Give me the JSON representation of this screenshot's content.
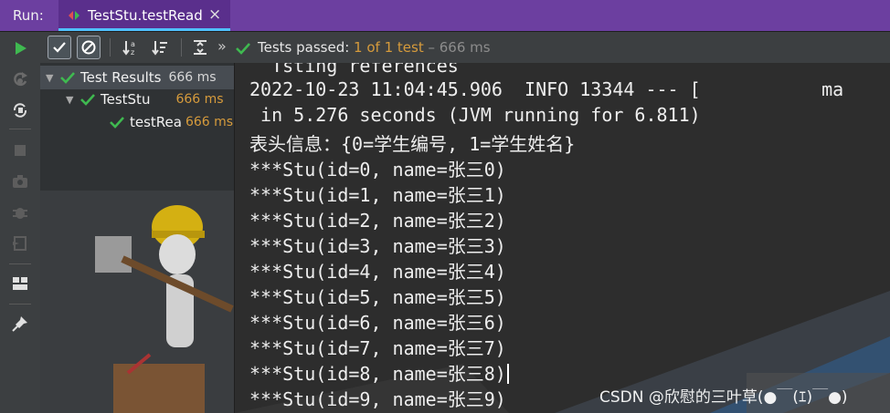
{
  "run_bar": {
    "label": "Run:",
    "tab_title": "TestStu.testRead",
    "close_glyph": "×"
  },
  "toolbar": {
    "overflow_glyph": "»",
    "status_passed": "Tests passed: ",
    "status_count": "1 of 1 test",
    "status_duration": "– 666 ms"
  },
  "tree": {
    "root": {
      "label": "Test Results",
      "time": "666 ms"
    },
    "class_node": {
      "label": "TestStu",
      "time": "666 ms"
    },
    "method_node": {
      "label": "testRea",
      "time": "666 ms"
    }
  },
  "console": {
    "lines": [
      "  Tsting references",
      "2022-10-23 11:04:45.906  INFO 13344 --- [           ma",
      " in 5.276 seconds (JVM running for 6.811)",
      "表头信息：{0=学生编号, 1=学生姓名}",
      "***Stu(id=0, name=张三0)",
      "***Stu(id=1, name=张三1)",
      "***Stu(id=2, name=张三2)",
      "***Stu(id=3, name=张三3)",
      "***Stu(id=4, name=张三4)",
      "***Stu(id=5, name=张三5)",
      "***Stu(id=6, name=张三6)",
      "***Stu(id=7, name=张三7)",
      "***Stu(id=8, name=张三8)",
      "***Stu(id=9, name=张三9)"
    ]
  },
  "watermark": "CSDN @欣慰的三叶草(●￣(ｴ)￣●)",
  "colors": {
    "accent_purple": "#6c3fa0",
    "pass_green": "#3fb950",
    "time_orange": "#d69b3c"
  },
  "icons": {
    "left_toolbar": [
      "run-icon",
      "rerun-failed-icon",
      "toggle-auto-test-icon",
      "stop-icon",
      "camera-icon",
      "debug-icon",
      "import-icon",
      "layout-icon",
      "pin-icon"
    ],
    "test_toolbar": [
      "show-passed-icon",
      "show-ignored-icon",
      "sort-alpha-icon",
      "sort-duration-icon",
      "expand-all-icon"
    ]
  }
}
